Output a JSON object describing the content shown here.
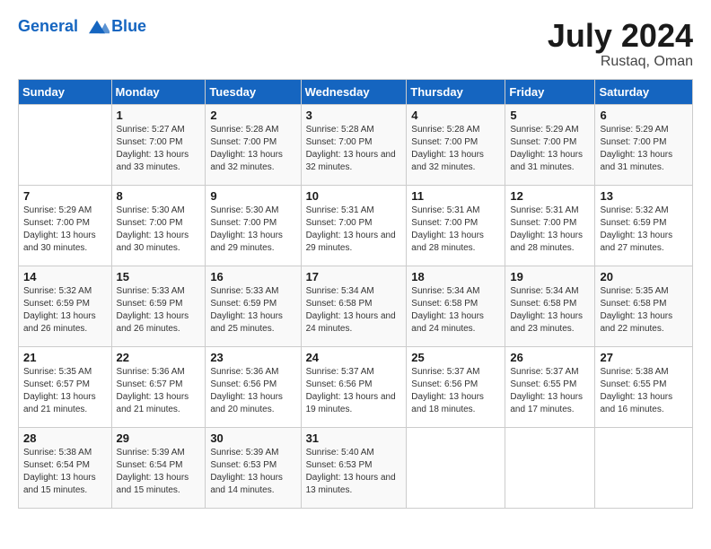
{
  "header": {
    "logo_line1": "General",
    "logo_line2": "Blue",
    "month_year": "July 2024",
    "location": "Rustaq, Oman"
  },
  "weekdays": [
    "Sunday",
    "Monday",
    "Tuesday",
    "Wednesday",
    "Thursday",
    "Friday",
    "Saturday"
  ],
  "weeks": [
    [
      {
        "day": "",
        "sunrise": "",
        "sunset": "",
        "daylight": ""
      },
      {
        "day": "1",
        "sunrise": "5:27 AM",
        "sunset": "7:00 PM",
        "daylight": "13 hours and 33 minutes."
      },
      {
        "day": "2",
        "sunrise": "5:28 AM",
        "sunset": "7:00 PM",
        "daylight": "13 hours and 32 minutes."
      },
      {
        "day": "3",
        "sunrise": "5:28 AM",
        "sunset": "7:00 PM",
        "daylight": "13 hours and 32 minutes."
      },
      {
        "day": "4",
        "sunrise": "5:28 AM",
        "sunset": "7:00 PM",
        "daylight": "13 hours and 32 minutes."
      },
      {
        "day": "5",
        "sunrise": "5:29 AM",
        "sunset": "7:00 PM",
        "daylight": "13 hours and 31 minutes."
      },
      {
        "day": "6",
        "sunrise": "5:29 AM",
        "sunset": "7:00 PM",
        "daylight": "13 hours and 31 minutes."
      }
    ],
    [
      {
        "day": "7",
        "sunrise": "5:29 AM",
        "sunset": "7:00 PM",
        "daylight": "13 hours and 30 minutes."
      },
      {
        "day": "8",
        "sunrise": "5:30 AM",
        "sunset": "7:00 PM",
        "daylight": "13 hours and 30 minutes."
      },
      {
        "day": "9",
        "sunrise": "5:30 AM",
        "sunset": "7:00 PM",
        "daylight": "13 hours and 29 minutes."
      },
      {
        "day": "10",
        "sunrise": "5:31 AM",
        "sunset": "7:00 PM",
        "daylight": "13 hours and 29 minutes."
      },
      {
        "day": "11",
        "sunrise": "5:31 AM",
        "sunset": "7:00 PM",
        "daylight": "13 hours and 28 minutes."
      },
      {
        "day": "12",
        "sunrise": "5:31 AM",
        "sunset": "7:00 PM",
        "daylight": "13 hours and 28 minutes."
      },
      {
        "day": "13",
        "sunrise": "5:32 AM",
        "sunset": "6:59 PM",
        "daylight": "13 hours and 27 minutes."
      }
    ],
    [
      {
        "day": "14",
        "sunrise": "5:32 AM",
        "sunset": "6:59 PM",
        "daylight": "13 hours and 26 minutes."
      },
      {
        "day": "15",
        "sunrise": "5:33 AM",
        "sunset": "6:59 PM",
        "daylight": "13 hours and 26 minutes."
      },
      {
        "day": "16",
        "sunrise": "5:33 AM",
        "sunset": "6:59 PM",
        "daylight": "13 hours and 25 minutes."
      },
      {
        "day": "17",
        "sunrise": "5:34 AM",
        "sunset": "6:58 PM",
        "daylight": "13 hours and 24 minutes."
      },
      {
        "day": "18",
        "sunrise": "5:34 AM",
        "sunset": "6:58 PM",
        "daylight": "13 hours and 24 minutes."
      },
      {
        "day": "19",
        "sunrise": "5:34 AM",
        "sunset": "6:58 PM",
        "daylight": "13 hours and 23 minutes."
      },
      {
        "day": "20",
        "sunrise": "5:35 AM",
        "sunset": "6:58 PM",
        "daylight": "13 hours and 22 minutes."
      }
    ],
    [
      {
        "day": "21",
        "sunrise": "5:35 AM",
        "sunset": "6:57 PM",
        "daylight": "13 hours and 21 minutes."
      },
      {
        "day": "22",
        "sunrise": "5:36 AM",
        "sunset": "6:57 PM",
        "daylight": "13 hours and 21 minutes."
      },
      {
        "day": "23",
        "sunrise": "5:36 AM",
        "sunset": "6:56 PM",
        "daylight": "13 hours and 20 minutes."
      },
      {
        "day": "24",
        "sunrise": "5:37 AM",
        "sunset": "6:56 PM",
        "daylight": "13 hours and 19 minutes."
      },
      {
        "day": "25",
        "sunrise": "5:37 AM",
        "sunset": "6:56 PM",
        "daylight": "13 hours and 18 minutes."
      },
      {
        "day": "26",
        "sunrise": "5:37 AM",
        "sunset": "6:55 PM",
        "daylight": "13 hours and 17 minutes."
      },
      {
        "day": "27",
        "sunrise": "5:38 AM",
        "sunset": "6:55 PM",
        "daylight": "13 hours and 16 minutes."
      }
    ],
    [
      {
        "day": "28",
        "sunrise": "5:38 AM",
        "sunset": "6:54 PM",
        "daylight": "13 hours and 15 minutes."
      },
      {
        "day": "29",
        "sunrise": "5:39 AM",
        "sunset": "6:54 PM",
        "daylight": "13 hours and 15 minutes."
      },
      {
        "day": "30",
        "sunrise": "5:39 AM",
        "sunset": "6:53 PM",
        "daylight": "13 hours and 14 minutes."
      },
      {
        "day": "31",
        "sunrise": "5:40 AM",
        "sunset": "6:53 PM",
        "daylight": "13 hours and 13 minutes."
      },
      {
        "day": "",
        "sunrise": "",
        "sunset": "",
        "daylight": ""
      },
      {
        "day": "",
        "sunrise": "",
        "sunset": "",
        "daylight": ""
      },
      {
        "day": "",
        "sunrise": "",
        "sunset": "",
        "daylight": ""
      }
    ]
  ]
}
